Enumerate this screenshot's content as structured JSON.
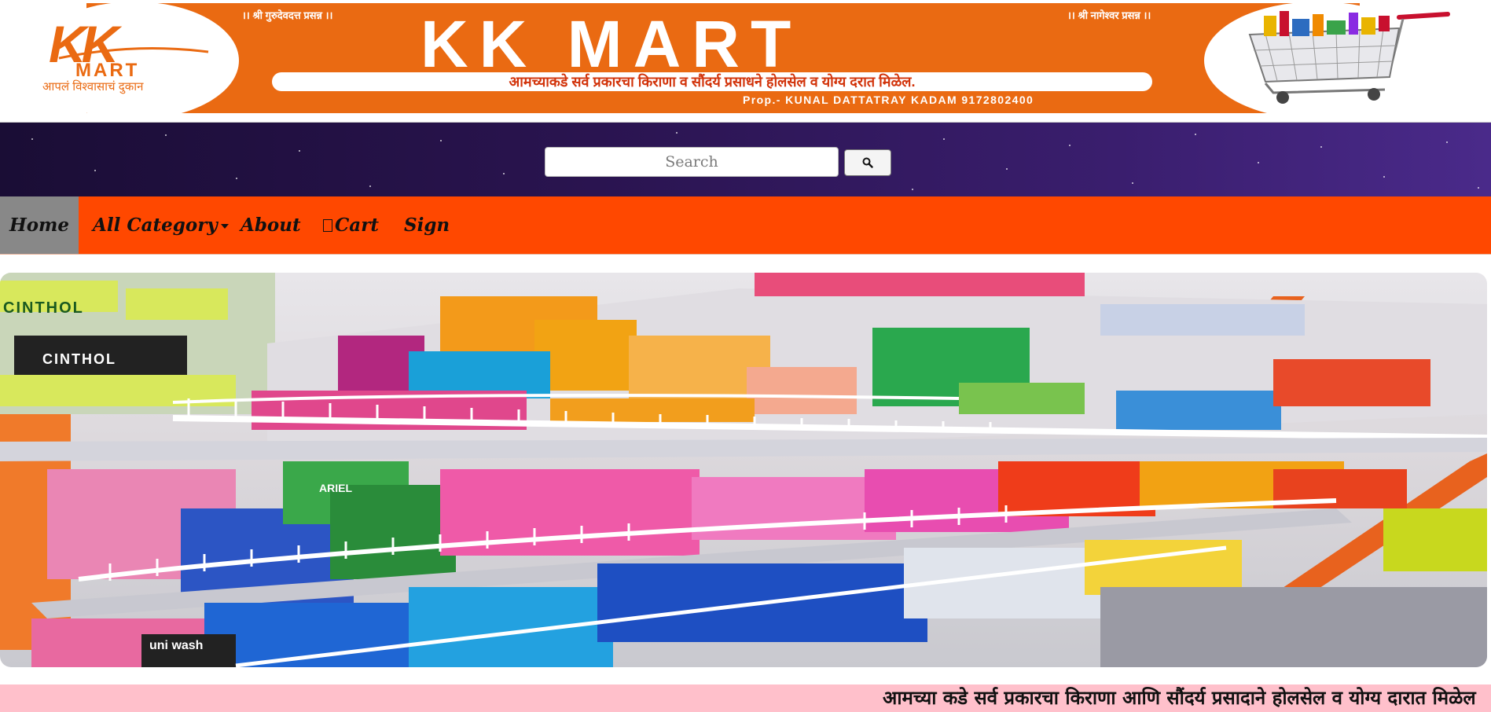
{
  "banner": {
    "logo_letters": "KK",
    "logo_word": "MART",
    "logo_tagline": "आपलं विश्वासाचं दुकान",
    "blessing_left": "।। श्री गुरुदेवदत्त प्रसन्न ।।",
    "blessing_right": "।। श्री नागेश्वर प्रसन्न ।।",
    "title": "KK MART",
    "tagline": "आमच्याकडे सर्व प्रकारचा किराणा व सौंदर्य प्रसाधने होलसेल व योग्य दरात मिळेल.",
    "proprietor": "Prop.- KUNAL DATTATRAY KADAM 9172802400",
    "cart_icon": "shopping-cart-icon"
  },
  "search": {
    "placeholder": "Search",
    "value": "",
    "button_icon": "search-icon"
  },
  "nav": {
    "home": "Home",
    "category": "All Category",
    "about": "About",
    "cart": "Cart",
    "sign": "Sign",
    "active": "Home"
  },
  "hero": {
    "shelf_labels": [
      "CINTHOL",
      "CINTHOL",
      "ARIEL",
      "uni wash"
    ]
  },
  "marquee": {
    "text": "आमच्या कडे सर्व प्रकारचा किराणा आणि सौंदर्य प्रसादाने होलसेल व योग्य दारात मिळेल"
  },
  "colors": {
    "banner_orange": "#ea6a12",
    "nav_bg": "#ff4800",
    "nav_active": "#888888",
    "marquee_bg": "#ffc0cb",
    "search_band": "#2a1450"
  }
}
